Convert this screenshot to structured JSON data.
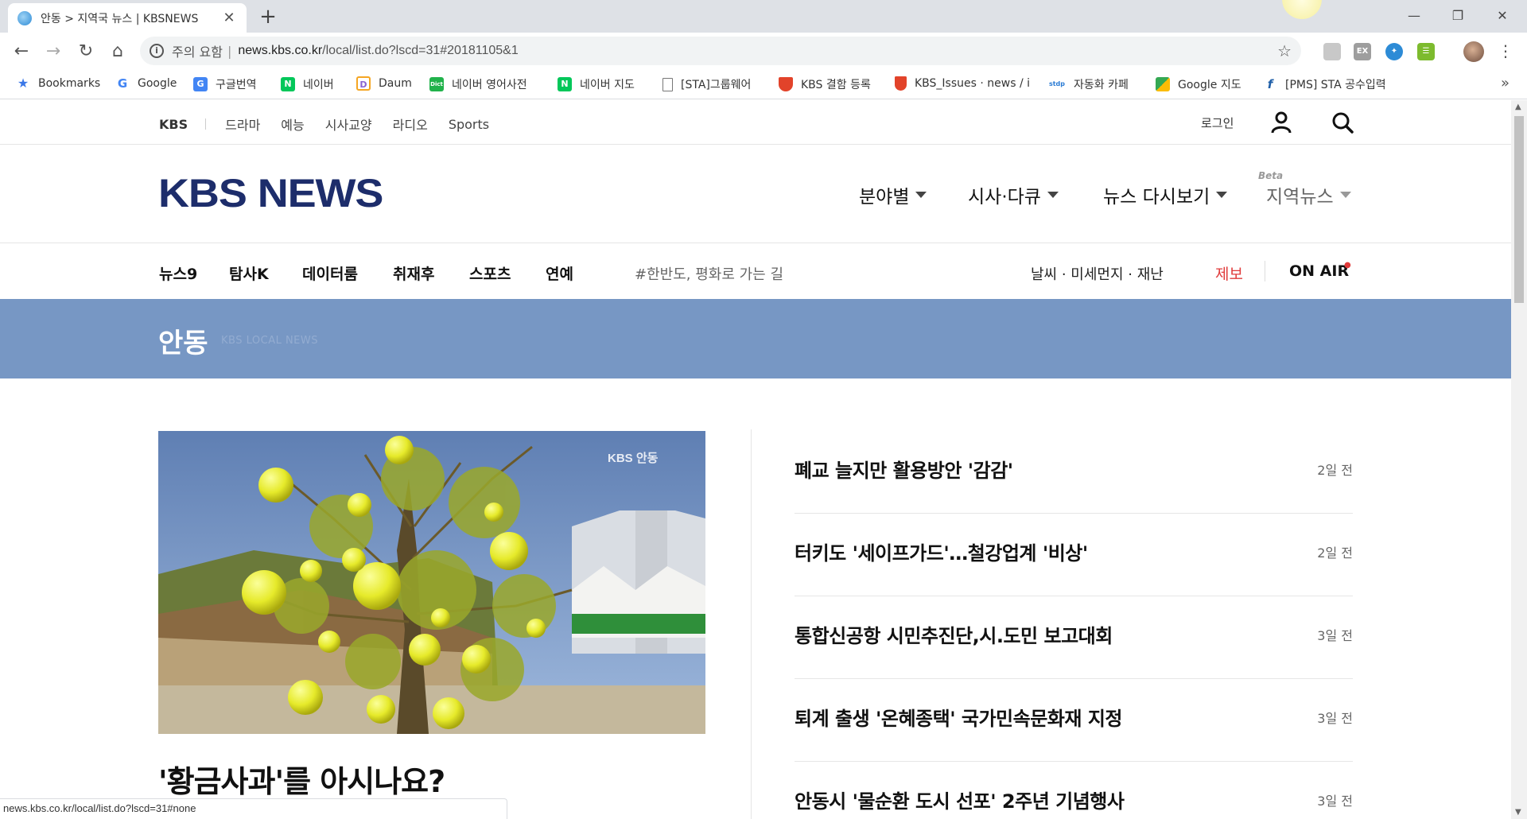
{
  "browser": {
    "tab_title": "안동 > 지역국 뉴스 | KBSNEWS",
    "url_warning": "주의 요함",
    "url_host": "news.kbs.co.kr",
    "url_path": "/local/list.do?lscd=31#20181105&1",
    "bookmarks": [
      {
        "label": "Bookmarks",
        "icon": "star-icon",
        "color": "#3b78e7"
      },
      {
        "label": "Google",
        "icon": "google-icon",
        "color": "#4285f4"
      },
      {
        "label": "구글번역",
        "icon": "translate-icon",
        "color": "#4285f4"
      },
      {
        "label": "네이버",
        "icon": "naver-icon",
        "color": "#03c75a"
      },
      {
        "label": "Daum",
        "icon": "daum-icon",
        "color": "#8a63d2"
      },
      {
        "label": "네이버 영어사전",
        "icon": "dict-icon",
        "color": "#21b24b"
      },
      {
        "label": "네이버 지도",
        "icon": "naver-map-icon",
        "color": "#03c75a"
      },
      {
        "label": "[STA]그룹웨어",
        "icon": "page-icon",
        "color": "#ffffff"
      },
      {
        "label": "KBS 결함 등록",
        "icon": "gitlab-icon",
        "color": "#e2432a"
      },
      {
        "label": "KBS_Issues · news / i",
        "icon": "gitlab-icon",
        "color": "#e2432a"
      },
      {
        "label": "자동화 카페",
        "icon": "stdp-icon",
        "color": "#2a7bd4"
      },
      {
        "label": "Google 지도",
        "icon": "maps-icon",
        "color": "#34a853"
      },
      {
        "label": "[PMS] STA 공수입력",
        "icon": "pms-icon",
        "color": "#1f5fa8"
      }
    ],
    "status_url": "news.kbs.co.kr/local/list.do?lscd=31#none"
  },
  "site": {
    "util": {
      "brand": "KBS",
      "links": [
        "드라마",
        "예능",
        "시사교양",
        "라디오",
        "Sports"
      ],
      "login": "로그인"
    },
    "logo": "KBS NEWS",
    "main_nav": [
      {
        "label": "분야별"
      },
      {
        "label": "시사·다큐"
      },
      {
        "label": "뉴스 다시보기"
      },
      {
        "label": "지역뉴스"
      }
    ],
    "beta_badge": "Beta",
    "sub_nav": [
      "뉴스9",
      "탐사K",
      "데이터룸",
      "취재후",
      "스포츠",
      "연예"
    ],
    "hashtag": "#한반도, 평화로 가는 길",
    "weather_link": "날씨 · 미세먼지 · 재난",
    "report_link": "제보",
    "on_air": "ON AIR",
    "on_air_dot": "●",
    "region": "안동",
    "region_sub": "KBS LOCAL NEWS",
    "featured": {
      "title": "'황금사과'를 아시나요?",
      "watermark": "KBS 안동"
    },
    "news": [
      {
        "headline": "폐교 늘지만 활용방안 '감감'",
        "time": "2일 전"
      },
      {
        "headline": "터키도 '세이프가드'…철강업계 '비상'",
        "time": "2일 전"
      },
      {
        "headline": "통합신공항 시민추진단,시.도민 보고대회",
        "time": "3일 전"
      },
      {
        "headline": "퇴계 출생 '온혜종택' 국가민속문화재 지정",
        "time": "3일 전"
      },
      {
        "headline": "안동시 '물순환 도시 선포' 2주년 기념행사",
        "time": "3일 전"
      }
    ],
    "colors": {
      "banner": "#7797c4",
      "logo": "#1d2d6b",
      "report": "#e03a3a"
    }
  }
}
